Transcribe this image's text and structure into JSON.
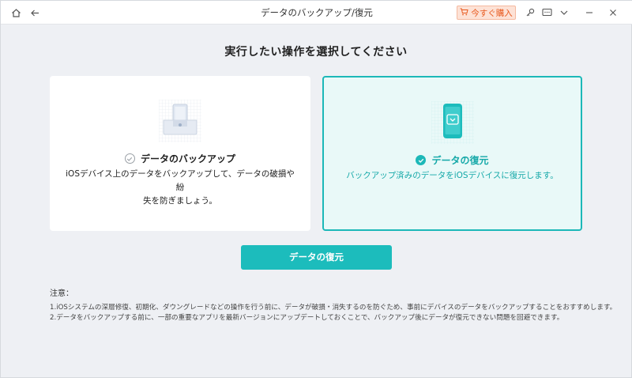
{
  "window": {
    "title": "データのバックアップ/復元"
  },
  "titlebar": {
    "buy_label": "今すぐ購入"
  },
  "main": {
    "heading": "実行したい操作を選択してください",
    "cards": [
      {
        "label": "データのバックアップ",
        "desc_line1": "iOSデバイス上のデータをバックアップして、データの破損や紛",
        "desc_line2": "失を防ぎましょう。",
        "selected": false
      },
      {
        "label": "データの復元",
        "desc_line1": "バックアップ済みのデータをiOSデバイスに復元します。",
        "selected": true
      }
    ],
    "primary_button": "データの復元"
  },
  "notes": {
    "title": "注意：",
    "items": [
      "1.iOSシステムの深層修復、初期化、ダウングレードなどの操作を行う前に、データが破損・消失するのを防ぐため、事前にデバイスのデータをバックアップすることをおすすめします。",
      "2.データをバックアップする前に、一部の重要なアプリを最新バージョンにアップデートしておくことで、バックアップ後にデータが復元できない問題を回避できます。"
    ]
  },
  "colors": {
    "accent": "#1cbcbc",
    "buy": "#e85a1f",
    "background": "#eef0f4"
  },
  "icons": [
    "home-icon",
    "back-arrow-icon",
    "cart-icon",
    "key-icon",
    "feedback-icon",
    "chevron-down-icon",
    "minimize-icon",
    "close-icon",
    "ipad-dock-icon",
    "phone-restore-icon",
    "check-icon"
  ]
}
